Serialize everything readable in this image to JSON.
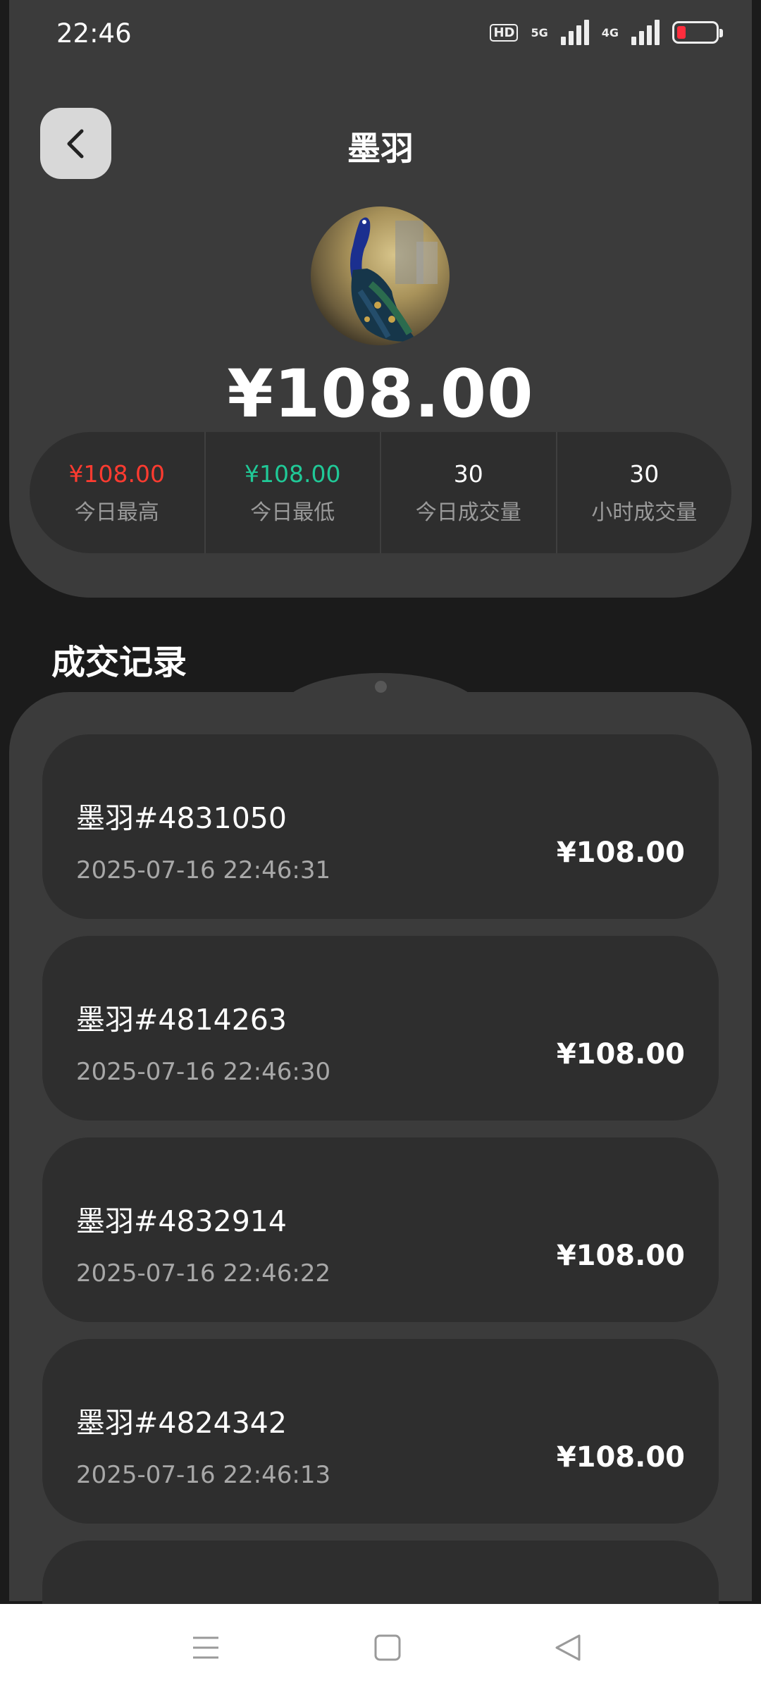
{
  "status_bar": {
    "time": "22:46",
    "hd_label": "HD",
    "net1_label": "5G",
    "net2_label": "4G",
    "battery_color": "#ff2d3d"
  },
  "header": {
    "title": "墨羽",
    "back_icon": "chevron-left-icon"
  },
  "item": {
    "price": "¥108.00",
    "avatar": "peacock-painting"
  },
  "stats": [
    {
      "value": "¥108.00",
      "label": "今日最高",
      "color": "#ff3b30"
    },
    {
      "value": "¥108.00",
      "label": "今日最低",
      "color": "#20c997"
    },
    {
      "value": "30",
      "label": "今日成交量"
    },
    {
      "value": "30",
      "label": "小时成交量"
    }
  ],
  "records_section": {
    "title": "成交记录",
    "records": [
      {
        "name": "墨羽#4831050",
        "time": "2025-07-16 22:46:31",
        "amount": "¥108.00"
      },
      {
        "name": "墨羽#4814263",
        "time": "2025-07-16 22:46:30",
        "amount": "¥108.00"
      },
      {
        "name": "墨羽#4832914",
        "time": "2025-07-16 22:46:22",
        "amount": "¥108.00"
      },
      {
        "name": "墨羽#4824342",
        "time": "2025-07-16 22:46:13",
        "amount": "¥108.00"
      }
    ]
  },
  "nav_bar": {
    "icons": [
      "menu-icon",
      "home-square-icon",
      "back-triangle-icon"
    ]
  }
}
